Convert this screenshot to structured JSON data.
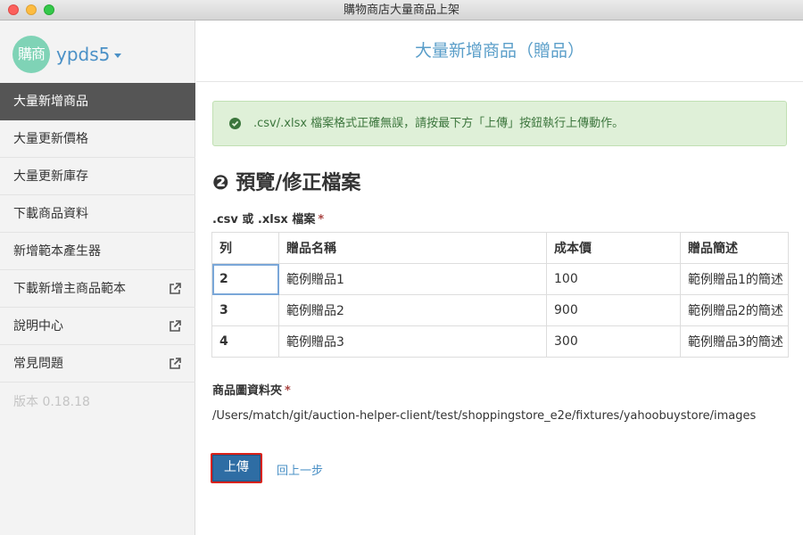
{
  "window": {
    "title": "購物商店大量商品上架"
  },
  "brand": {
    "logo_text": "購商",
    "name": "ypds5"
  },
  "sidebar": {
    "items": [
      {
        "label": "大量新增商品",
        "active": true,
        "external": false
      },
      {
        "label": "大量更新價格",
        "active": false,
        "external": false
      },
      {
        "label": "大量更新庫存",
        "active": false,
        "external": false
      },
      {
        "label": "下載商品資料",
        "active": false,
        "external": false
      },
      {
        "label": "新增範本產生器",
        "active": false,
        "external": false
      },
      {
        "label": "下載新增主商品範本",
        "active": false,
        "external": true
      },
      {
        "label": "說明中心",
        "active": false,
        "external": true
      },
      {
        "label": "常見問題",
        "active": false,
        "external": true
      }
    ],
    "version": "版本 0.18.18"
  },
  "main": {
    "header": "大量新增商品（贈品）",
    "alert": ".csv/.xlsx 檔案格式正確無誤，請按最下方「上傳」按鈕執行上傳動作。",
    "section_title": "❷ 預覽/修正檔案",
    "file_label": ".csv 或 .xlsx 檔案",
    "required_mark": "*",
    "table": {
      "headers": [
        "列",
        "贈品名稱",
        "成本價",
        "贈品簡述"
      ],
      "rows": [
        [
          "2",
          "範例贈品1",
          "100",
          "範例贈品1的簡述"
        ],
        [
          "3",
          "範例贈品2",
          "900",
          "範例贈品2的簡述"
        ],
        [
          "4",
          "範例贈品3",
          "300",
          "範例贈品3的簡述"
        ]
      ]
    },
    "folder_label": "商品圖資料夾",
    "folder_path": "/Users/match/git/auction-helper-client/test/shoppingstore_e2e/fixtures/yahoobuystore/images",
    "upload_label": "上傳",
    "back_label": "回上一步"
  },
  "colors": {
    "accent": "#4a90c6",
    "primary_button": "#2e6da4",
    "highlight_border": "#d9231a",
    "success_bg": "#dff0d8",
    "success_text": "#3c763d",
    "sidebar_active": "#555555"
  }
}
